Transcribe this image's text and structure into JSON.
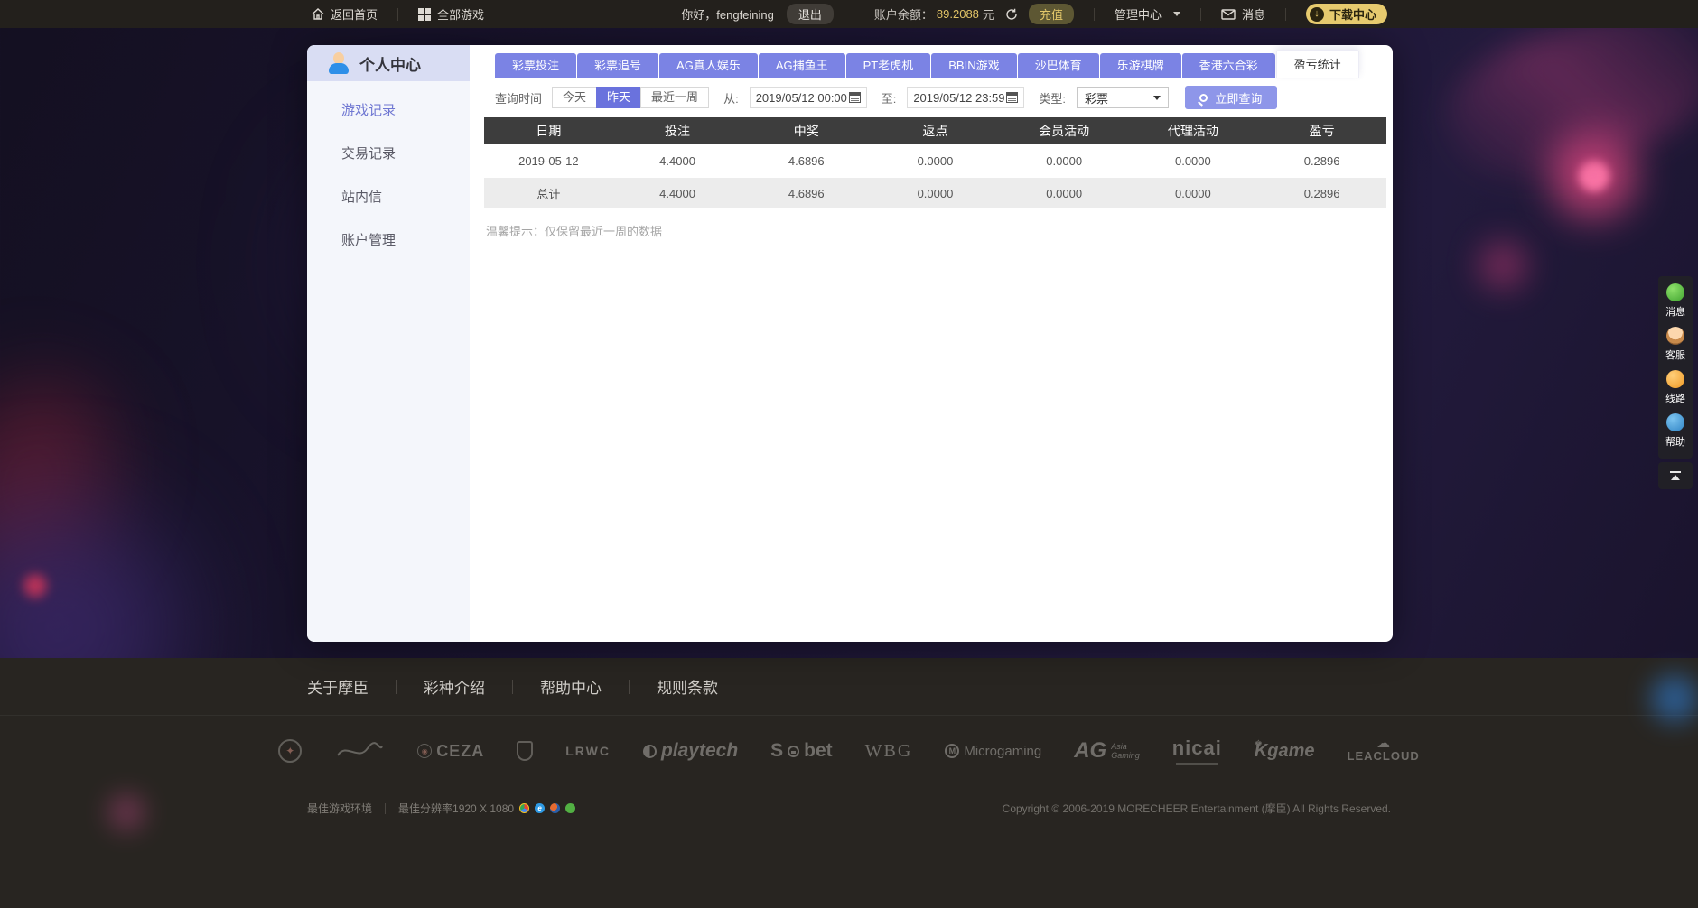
{
  "topbar": {
    "back_home": "返回首页",
    "all_games": "全部游戏",
    "greeting": "你好，fengfeining",
    "logout": "退出",
    "balance_label": "账户余额：",
    "balance_value": "89.2088",
    "balance_unit": "元",
    "recharge": "充值",
    "admin_center": "管理中心",
    "messages": "消息",
    "download_center": "下载中心"
  },
  "sidebar": {
    "title": "个人中心",
    "items": [
      "游戏记录",
      "交易记录",
      "站内信",
      "账户管理"
    ]
  },
  "tabs": [
    "彩票投注",
    "彩票追号",
    "AG真人娱乐",
    "AG捕鱼王",
    "PT老虎机",
    "BBIN游戏",
    "沙巴体育",
    "乐游棋牌",
    "香港六合彩",
    "盈亏统计"
  ],
  "query": {
    "time_label": "查询时间",
    "today": "今天",
    "yesterday": "昨天",
    "last_week": "最近一周",
    "from_label": "从:",
    "from_value": "2019/05/12 00:00",
    "to_label": "至:",
    "to_value": "2019/05/12 23:59",
    "type_label": "类型:",
    "type_value": "彩票",
    "search_button": "立即查询"
  },
  "table": {
    "headers": [
      "日期",
      "投注",
      "中奖",
      "返点",
      "会员活动",
      "代理活动",
      "盈亏"
    ],
    "rows": [
      [
        "2019-05-12",
        "4.4000",
        "4.6896",
        "0.0000",
        "0.0000",
        "0.0000",
        "0.2896"
      ],
      [
        "总计",
        "4.4000",
        "4.6896",
        "0.0000",
        "0.0000",
        "0.0000",
        "0.2896"
      ]
    ],
    "note": "温馨提示：仅保留最近一周的数据"
  },
  "footer": {
    "links": [
      "关于摩臣",
      "彩种介绍",
      "帮助中心",
      "规则条款"
    ],
    "logos": {
      "ceza": "CEZA",
      "lrwc": "LRWC",
      "playtech": "playtech",
      "sbobet_s": "S",
      "sbobet_bet": "bet",
      "wbg": "WBG",
      "microgaming_m": "M",
      "microgaming": "Microgaming",
      "ag": "AG",
      "ag_sub1": "Asia",
      "ag_sub2": "Gaming",
      "nicai": "nicai",
      "kgame": "Kgame",
      "kgame_crown": "♚",
      "leacloud_cloud": "☁",
      "leacloud": "LEACLOUD"
    },
    "env_note": "最佳游戏环境",
    "resolution_note": "最佳分辨率1920 X 1080",
    "browser_icons": [
      "chrome-icon",
      "ie-icon",
      "firefox-icon",
      "qq-browser-icon"
    ],
    "copyright": "Copyright © 2006-2019 MORECHEER Entertainment (摩臣) All Rights Reserved."
  },
  "floatbar": {
    "items": [
      "消息",
      "客服",
      "线路",
      "帮助"
    ]
  },
  "colors": {
    "accent_periwinkle": "#7b83e4",
    "accent_active_btn": "#6a72dd",
    "gold": "#e3c567",
    "gold_pill": "#e6ca6e",
    "table_header_bg": "#3d3d3d",
    "footer_bg": "#282521",
    "topbar_bg": "#23201c",
    "sidebar_bg": "#f4f6fb",
    "sidebar_head_bg": "#d9ddf3"
  }
}
